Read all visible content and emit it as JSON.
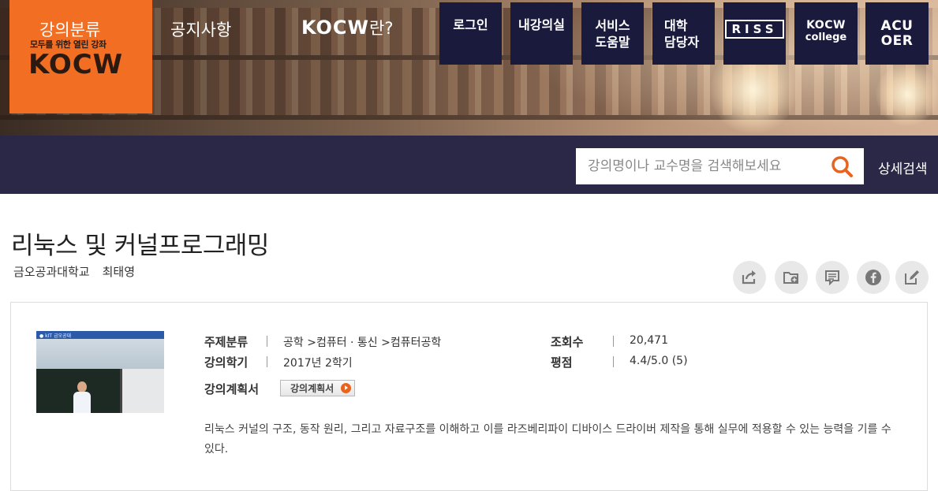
{
  "header": {
    "logo": {
      "tagline": "모두를 위한 열린 강좌",
      "wordmark": "KOCW"
    },
    "quick_links": {
      "login": "로그인",
      "my_courses": "내강의실",
      "service_help_1": "서비스",
      "service_help_2": "도움말",
      "univ_manager_1": "대학",
      "univ_manager_2": "담당자",
      "riss": "RISS",
      "kocw_college_1": "KOCW",
      "kocw_college_2": "college",
      "acu_oer_1": "ACU",
      "acu_oer_2": "OER"
    }
  },
  "nav": {
    "category": "강의분류",
    "notice": "공지사항",
    "about_brand": "KOCW",
    "about_suffix": "란?",
    "search_placeholder": "강의명이나 교수명을 검색해보세요",
    "detail_search": "상세검색"
  },
  "course": {
    "title": "리눅스 및 커널프로그래밍",
    "university": "금오공과대학교",
    "professor": "최태영",
    "thumb_logo": "● kIT 금오공대",
    "subject_label": "주제분류",
    "subject_value": "공학 >컴퓨터 · 통신 >컴퓨터공학",
    "semester_label": "강의학기",
    "semester_value": "2017년 2학기",
    "plan_label": "강의계획서",
    "plan_button": "강의계획서",
    "views_label": "조회수",
    "views_value": "20,471",
    "rating_label": "평점",
    "rating_value": "4.4/5.0 (5)",
    "description": "리눅스 커널의 구조, 동작 원리, 그리고 자료구조를 이해하고 이를 라즈베리파이 디바이스 드라이버 제작을 통해 실무에 적용할 수 있는 능력을 기를 수 있다."
  },
  "actions": [
    "share-icon",
    "folder-add-icon",
    "comment-icon",
    "facebook-icon",
    "edit-icon"
  ],
  "colors": {
    "brand_orange": "#f26e22",
    "nav_bg": "#2a2846",
    "quick_bg": "#1a1a3c",
    "search_icon": "#e8641e"
  }
}
